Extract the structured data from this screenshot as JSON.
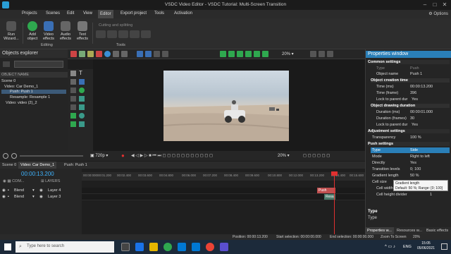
{
  "window": {
    "title": "VSDC Video Editor - VSDC Tutorial: Multi-Screen Transition",
    "options_label": "Options"
  },
  "menu": [
    "Projects",
    "Scenes",
    "Edit",
    "View",
    "Editor",
    "Export project",
    "Tools",
    "Activation"
  ],
  "menu_active": "Editor",
  "ribbon": {
    "run_wizard": "Run\nWizard...",
    "add_object": "Add\nobject",
    "video_effects": "Video\neffects",
    "audio_effects": "Audio\neffects",
    "text_effects": "Text\neffects",
    "editing_group": "Editing",
    "cutting_label": "Cutting and splitting",
    "tools_group": "Tools"
  },
  "toolbar": {
    "zoom": "20%"
  },
  "objects_explorer": {
    "title": "Objects explorer",
    "column": "OBJECT NAME",
    "items": [
      {
        "label": "Scene 0",
        "indent": 0,
        "selected": false
      },
      {
        "label": "Video: Car Demo_1",
        "indent": 1,
        "selected": false
      },
      {
        "label": "Push: Push 1",
        "indent": 2,
        "selected": true
      },
      {
        "label": "Resample: Resample 1",
        "indent": 2,
        "selected": false
      },
      {
        "label": "Video: video (2)_2",
        "indent": 1,
        "selected": false
      }
    ]
  },
  "preview": {
    "quality": "720p",
    "zoom": "20%"
  },
  "properties": {
    "title": "Properties window",
    "common_settings": "Common settings",
    "type_key": "Type",
    "type_val": "Push",
    "object_name_key": "Object name",
    "object_name_val": "Push 1",
    "creation_time": "Object creation time",
    "time_ms_key": "Time (ms)",
    "time_ms_val": "00:00:13.200",
    "time_frame_key": "Time (frame)",
    "time_frame_val": "396",
    "lock_key": "Lock to parent dur",
    "lock_val": "Yes",
    "drawing_duration": "Object drawing duration",
    "dur_ms_key": "Duration (ms)",
    "dur_ms_val": "00:00:01.000",
    "dur_frames_key": "Duration (frames)",
    "dur_frames_val": "30",
    "lock2_key": "Lock to parent dur",
    "lock2_val": "Yes",
    "adjustment": "Adjustment settings",
    "transparency_key": "Transparency",
    "transparency_val": "100 %",
    "push_settings": "Push settings",
    "ptype_key": "Type",
    "ptype_val": "Side",
    "mode_key": "Mode",
    "mode_val": "Right to left",
    "directly_key": "Directly",
    "directly_val": "Yes",
    "trans_levels_key": "Transition levels",
    "trans_levels_val": "0; 100",
    "grad_key": "Gradient length",
    "grad_val": "50 %",
    "cell_size": "Cell size",
    "cell_width_key": "Cell width divider",
    "cell_width_val": "1",
    "cell_height_key": "Cell height divider",
    "cell_height_val": "1",
    "footer_title": "Type",
    "footer_desc": "Type",
    "tooltip_title": "Gradient length",
    "tooltip_body": "Default: 50 %; Range: [0; 100]"
  },
  "timeline": {
    "tabs": [
      "Scene 0",
      "Video: Car Demo_1",
      "Push: Push 1"
    ],
    "active_tab": "Video: Car Demo_1",
    "timecode": "00:00:13.200",
    "col_com": "COM...",
    "col_layers": "LAYERS",
    "ruler": [
      "00:00:000",
      "00:01.200",
      "00:02.400",
      "00:03.600",
      "00:04.800",
      "00:06.000",
      "00:07.200",
      "00:08.400",
      "00:09.600",
      "00:10.800",
      "00:12.000",
      "00:13.200",
      "00:14.400",
      "00:15.600"
    ],
    "layers": [
      {
        "blend": "Blend",
        "name": "Layer 4",
        "clip": "Push"
      },
      {
        "blend": "Blend",
        "name": "Layer 3",
        "clip": "Resa"
      }
    ]
  },
  "statusbar": {
    "position": "Position:  00:00:13.200",
    "start": "Start selection:  00:00:00.000",
    "end": "End selection:  00:00:00.000",
    "zoom": "Zoom To Screen",
    "zoom_pct": "20%"
  },
  "bottom_tabs": [
    "Properties w...",
    "Resources w...",
    "Basic effects"
  ],
  "taskbar": {
    "search": "Type here to search",
    "lang": "ENG",
    "time": "15:05",
    "date": "05/06/2021"
  },
  "colors": {
    "accent": "#2a7fb8",
    "timecode": "#3fb4ff",
    "playhead": "#e03030",
    "push_clip": "#c05050",
    "resa_clip": "#4a7a6a"
  }
}
